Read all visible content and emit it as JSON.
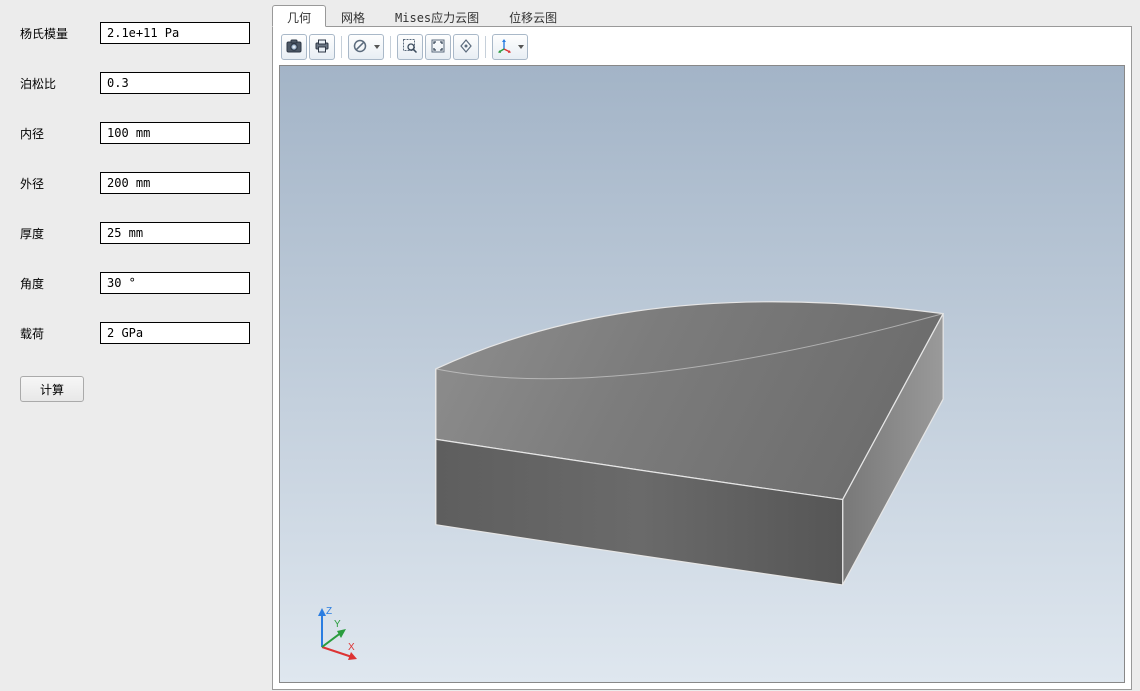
{
  "form": {
    "rows": [
      {
        "label": "杨氏模量",
        "value": "2.1e+11 Pa"
      },
      {
        "label": "泊松比",
        "value": "0.3"
      },
      {
        "label": "内径",
        "value": "100 mm"
      },
      {
        "label": "外径",
        "value": "200 mm"
      },
      {
        "label": "厚度",
        "value": "25 mm"
      },
      {
        "label": "角度",
        "value": "30 °"
      },
      {
        "label": "载荷",
        "value": "2 GPa"
      }
    ],
    "button": "计算"
  },
  "tabs": {
    "items": [
      {
        "label": "几何",
        "active": true
      },
      {
        "label": "网格",
        "active": false
      },
      {
        "label": "Mises应力云图",
        "active": false
      },
      {
        "label": "位移云图",
        "active": false
      }
    ]
  },
  "toolbar": {
    "camera": "camera-icon",
    "print": "print-icon",
    "disable": "disable-icon",
    "zoom_area": "zoom-area-icon",
    "fit": "fit-icon",
    "rotate": "rotate-icon",
    "axes": "axes-icon"
  },
  "triad": {
    "x": "X",
    "y": "Y",
    "z": "Z"
  }
}
